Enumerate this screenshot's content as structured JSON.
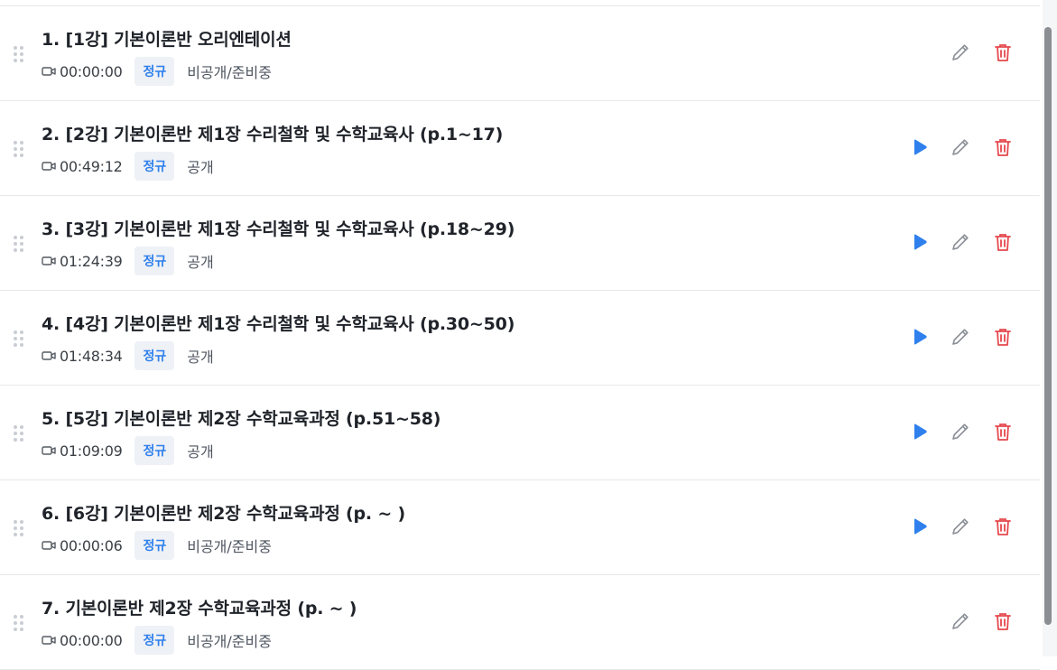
{
  "lectures": [
    {
      "title": "1. [1강] 기본이론반 오리엔테이션",
      "duration": "00:00:00",
      "badge": "정규",
      "status": "비공개/준비중",
      "has_play": false
    },
    {
      "title": "2. [2강] 기본이론반 제1장 수리철학 및 수학교육사 (p.1~17)",
      "duration": "00:49:12",
      "badge": "정규",
      "status": "공개",
      "has_play": true
    },
    {
      "title": "3. [3강] 기본이론반 제1장 수리철학 및 수학교육사 (p.18~29)",
      "duration": "01:24:39",
      "badge": "정규",
      "status": "공개",
      "has_play": true
    },
    {
      "title": "4. [4강] 기본이론반 제1장 수리철학 및 수학교육사 (p.30~50)",
      "duration": "01:48:34",
      "badge": "정규",
      "status": "공개",
      "has_play": true
    },
    {
      "title": "5. [5강] 기본이론반 제2장 수학교육과정 (p.51~58)",
      "duration": "01:09:09",
      "badge": "정규",
      "status": "공개",
      "has_play": true
    },
    {
      "title": "6. [6강] 기본이론반 제2장 수학교육과정 (p. ~ )",
      "duration": "00:00:06",
      "badge": "정규",
      "status": "비공개/준비중",
      "has_play": true
    },
    {
      "title": "7. 기본이론반 제2장 수학교육과정 (p. ~ )",
      "duration": "00:00:00",
      "badge": "정규",
      "status": "비공개/준비중",
      "has_play": false
    }
  ],
  "icons": {
    "drag": "drag-handle-icon",
    "duration": "video-camera-icon",
    "play": "play-icon",
    "edit": "pencil-icon",
    "delete": "trash-icon"
  },
  "colors": {
    "play": "#2f80ed",
    "edit": "#8a8f96",
    "delete": "#e5484d",
    "badge_bg": "#eef1f5",
    "badge_text": "#2f80ed"
  }
}
